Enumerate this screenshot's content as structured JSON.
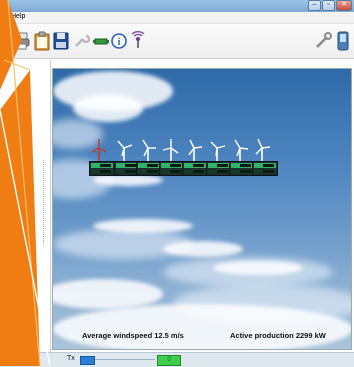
{
  "window": {
    "controls": [
      "–",
      "▫",
      "✕"
    ]
  },
  "menu": {
    "help_label": "Help"
  },
  "toolbar": {
    "icons": [
      "printer-icon",
      "clipboard-icon",
      "save-icon",
      "wrench-disabled-icon",
      "plug-icon",
      "info-icon",
      "signal-icon",
      "tools-icon",
      "device-icon"
    ]
  },
  "turbines": {
    "count": 8,
    "first_highlight_color": "#c0392b"
  },
  "info": {
    "windspeed_text": "Average windspeed 12.5 m/s",
    "production_text": "Active production 2299 kW"
  },
  "status": {
    "tx_label": "Tx",
    "green_label": "0"
  },
  "colors": {
    "accent_orange": "#f07c14",
    "readout_green": "#2fb46a"
  }
}
